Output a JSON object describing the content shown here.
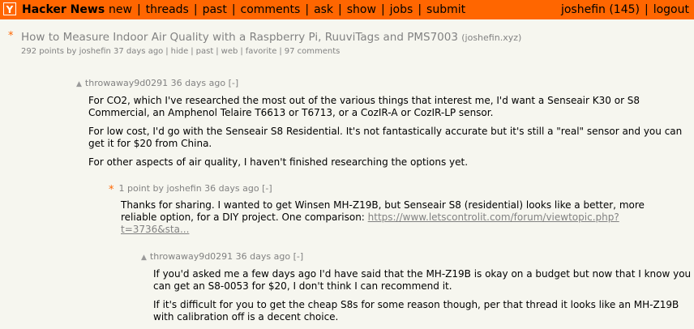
{
  "header": {
    "logo": "Y",
    "site_name": "Hacker News",
    "nav": [
      "new",
      "threads",
      "past",
      "comments",
      "ask",
      "show",
      "jobs",
      "submit"
    ],
    "user": "joshefin",
    "karma": "(145)",
    "logout": "logout"
  },
  "story": {
    "star": "*",
    "title": "How to Measure Indoor Air Quality with a Raspberry Pi, RuuviTags and PMS7003",
    "domain": "(joshefin.xyz)",
    "subtext": {
      "points": "292 points by joshefin 37 days ago",
      "hide": "hide",
      "past": "past",
      "web": "web",
      "favorite": "favorite",
      "comments": "97 comments"
    }
  },
  "comments": [
    {
      "arrow": "▲",
      "meta": "throwaway9d0291 36 days ago [-]",
      "paragraphs": [
        "For CO2, which I've researched the most out of the various things that interest me, I'd want a Senseair K30 or S8 Commercial, an Amphenol Telaire T6613 or T6713, or a CozIR-A or CozIR-LP sensor.",
        "For low cost, I'd go with the Senseair S8 Residential. It's not fantastically accurate but it's still a \"real\" sensor and you can get it for $20 from China.",
        "For other aspects of air quality, I haven't finished researching the options yet."
      ]
    },
    {
      "star": "*",
      "meta": "1 point by joshefin 36 days ago [-]",
      "text": "Thanks for sharing. I wanted to get Winsen MH-Z19B, but Senseair S8 (residential) looks like a better, more reliable option, for a DIY project. One comparison: ",
      "link": "https://www.letscontrolit.com/forum/viewtopic.php?t=3736&sta..."
    },
    {
      "arrow": "▲",
      "meta": "throwaway9d0291 36 days ago [-]",
      "paragraphs": [
        "If you'd asked me a few days ago I'd have said that the MH-Z19B is okay on a budget but now that I know you can get an S8-0053 for $20, I don't think I can recommend it.",
        "If it's difficult for you to get the cheap S8s for some reason though, per that thread it looks like an MH-Z19B with calibration off is a decent choice."
      ]
    }
  ]
}
